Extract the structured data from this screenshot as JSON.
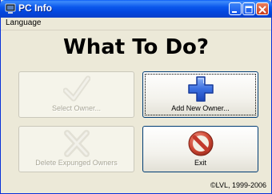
{
  "window": {
    "title": "PC Info",
    "controls": {
      "minimize": "minimize-icon",
      "maximize": "maximize-icon",
      "close": "close-icon"
    }
  },
  "menu": {
    "items": [
      {
        "label": "Language"
      }
    ]
  },
  "main": {
    "heading": "What To Do?",
    "buttons": {
      "select_owner": {
        "label": "Select Owner...",
        "icon": "checkmark-icon",
        "enabled": false
      },
      "add_new_owner": {
        "label": "Add New Owner...",
        "icon": "plus-icon",
        "enabled": true
      },
      "delete_expunged": {
        "label": "Delete Expunged Owners",
        "icon": "x-icon",
        "enabled": false
      },
      "exit": {
        "label": "Exit",
        "icon": "no-entry-icon",
        "enabled": true
      }
    }
  },
  "footer": {
    "copyright": "©LVL, 1999-2006"
  },
  "colors": {
    "titlebar": "#0a58ed",
    "dialog_bg": "#ece9d8",
    "plus_blue": "#2b63d6",
    "exit_red": "#c23a2c"
  }
}
